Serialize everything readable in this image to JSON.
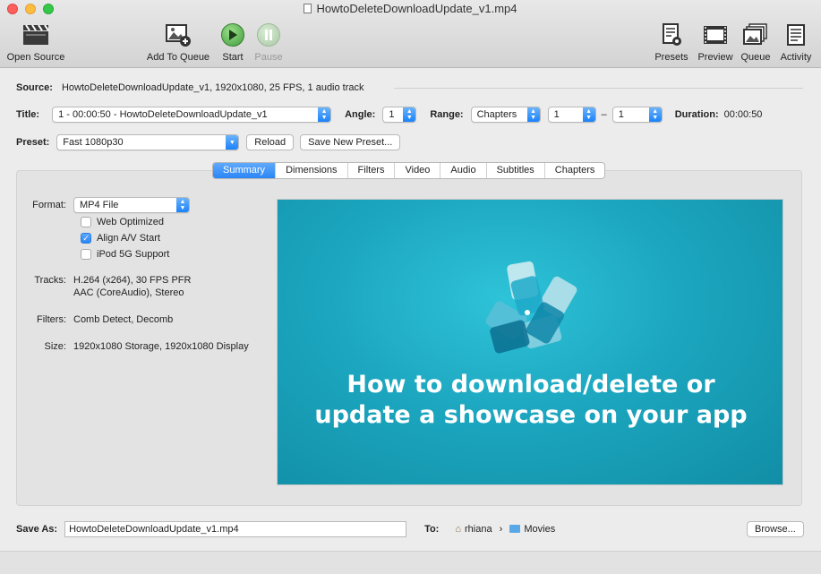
{
  "window": {
    "title": "HowtoDeleteDownloadUpdate_v1.mp4"
  },
  "toolbar": {
    "open_source": "Open Source",
    "add_to_queue": "Add To Queue",
    "start": "Start",
    "pause": "Pause",
    "presets": "Presets",
    "preview": "Preview",
    "queue": "Queue",
    "activity": "Activity"
  },
  "source": {
    "label": "Source:",
    "value": "HowtoDeleteDownloadUpdate_v1, 1920x1080, 25 FPS, 1 audio track"
  },
  "title_row": {
    "title_label": "Title:",
    "title_value": "1 - 00:00:50 - HowtoDeleteDownloadUpdate_v1",
    "angle_label": "Angle:",
    "angle_value": "1",
    "range_label": "Range:",
    "range_type": "Chapters",
    "range_start": "1",
    "range_sep": "–",
    "range_end": "1",
    "duration_label": "Duration:",
    "duration_value": "00:00:50"
  },
  "preset_row": {
    "label": "Preset:",
    "value": "Fast 1080p30",
    "reload": "Reload",
    "save_new": "Save New Preset..."
  },
  "tabs": [
    "Summary",
    "Dimensions",
    "Filters",
    "Video",
    "Audio",
    "Subtitles",
    "Chapters"
  ],
  "summary": {
    "format_label": "Format:",
    "format_value": "MP4 File",
    "web_optimized": "Web Optimized",
    "web_optimized_checked": false,
    "align_av": "Align A/V Start",
    "align_av_checked": true,
    "ipod": "iPod 5G Support",
    "ipod_checked": false,
    "tracks_label": "Tracks:",
    "tracks_line1": "H.264 (x264), 30 FPS PFR",
    "tracks_line2": "AAC (CoreAudio), Stereo",
    "filters_label": "Filters:",
    "filters_value": "Comb Detect, Decomb",
    "size_label": "Size:",
    "size_value": "1920x1080 Storage, 1920x1080 Display"
  },
  "preview": {
    "line1": "How to download/delete or",
    "line2": "update a showcase on your app"
  },
  "bottom": {
    "save_as_label": "Save As:",
    "save_as_value": "HowtoDeleteDownloadUpdate_v1.mp4",
    "to_label": "To:",
    "path_user": "rhiana",
    "path_sep": "›",
    "path_folder": "Movies",
    "browse": "Browse..."
  },
  "colors": {
    "accent": "#2a86f6",
    "preview_bg": "#1ca6bf"
  }
}
